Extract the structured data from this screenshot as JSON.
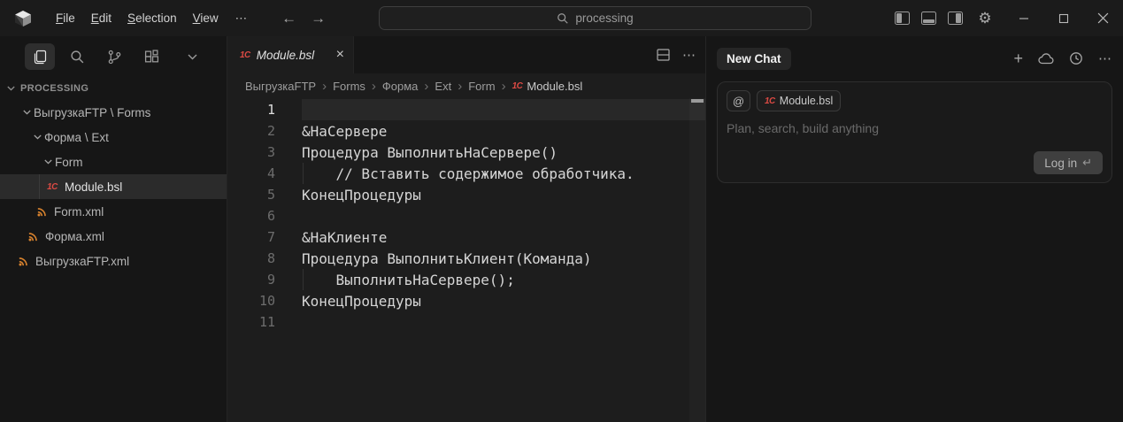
{
  "titlebar": {
    "menus": [
      {
        "label": "File"
      },
      {
        "label": "Edit"
      },
      {
        "label": "Selection"
      },
      {
        "label": "View"
      }
    ],
    "more_label": "⋯",
    "back_arrow": "←",
    "forward_arrow": "→",
    "search": {
      "value": "processing"
    }
  },
  "sidebar": {
    "section_title": "PROCESSING",
    "tree": [
      {
        "label": "ВыгрузкаFTP \\ Forms",
        "type": "folder"
      },
      {
        "label": "Форма \\ Ext",
        "type": "folder"
      },
      {
        "label": "Form",
        "type": "folder"
      },
      {
        "label": "Module.bsl",
        "type": "bsl-file",
        "selected": true
      },
      {
        "label": "Form.xml",
        "type": "xml-file"
      },
      {
        "label": "Форма.xml",
        "type": "xml-file"
      },
      {
        "label": "ВыгрузкаFTP.xml",
        "type": "xml-file"
      }
    ]
  },
  "editor": {
    "tab": {
      "label": "Module.bsl",
      "close_glyph": "×"
    },
    "tab_more": "⋯",
    "breadcrumbs": [
      "ВыгрузкаFTP",
      "Forms",
      "Форма",
      "Ext",
      "Form",
      "Module.bsl"
    ],
    "breadcrumb_sep": "›",
    "code": {
      "language": "1C BSL",
      "lines": [
        {
          "n": "1",
          "text": ""
        },
        {
          "n": "2",
          "text": "&НаСервере"
        },
        {
          "n": "3",
          "text": "Процедура ВыполнитьНаСервере()"
        },
        {
          "n": "4",
          "text": "    // Вставить содержимое обработчика."
        },
        {
          "n": "5",
          "text": "КонецПроцедуры"
        },
        {
          "n": "6",
          "text": ""
        },
        {
          "n": "7",
          "text": "&НаКлиенте"
        },
        {
          "n": "8",
          "text": "Процедура ВыполнитьКлиент(Команда)"
        },
        {
          "n": "9",
          "text": "    ВыполнитьНаСервере();"
        },
        {
          "n": "10",
          "text": "КонецПроцедуры"
        },
        {
          "n": "11",
          "text": ""
        }
      ]
    }
  },
  "chat": {
    "title": "New Chat",
    "plus_glyph": "+",
    "more_glyph": "⋯",
    "at_glyph": "@",
    "context_chip": "Module.bsl",
    "placeholder": "Plan, search, build anything",
    "login_label": "Log in",
    "login_key_glyph": "↵"
  },
  "icons_1c_glyph": "1С",
  "colors": {
    "accent_red_1c": "#dd4a44",
    "xml_orange": "#d9832e",
    "editor_bg": "#1d1d1d",
    "sidebar_bg": "#161616",
    "selection_bg": "#2b2b2b",
    "current_line_bg": "#282828"
  }
}
